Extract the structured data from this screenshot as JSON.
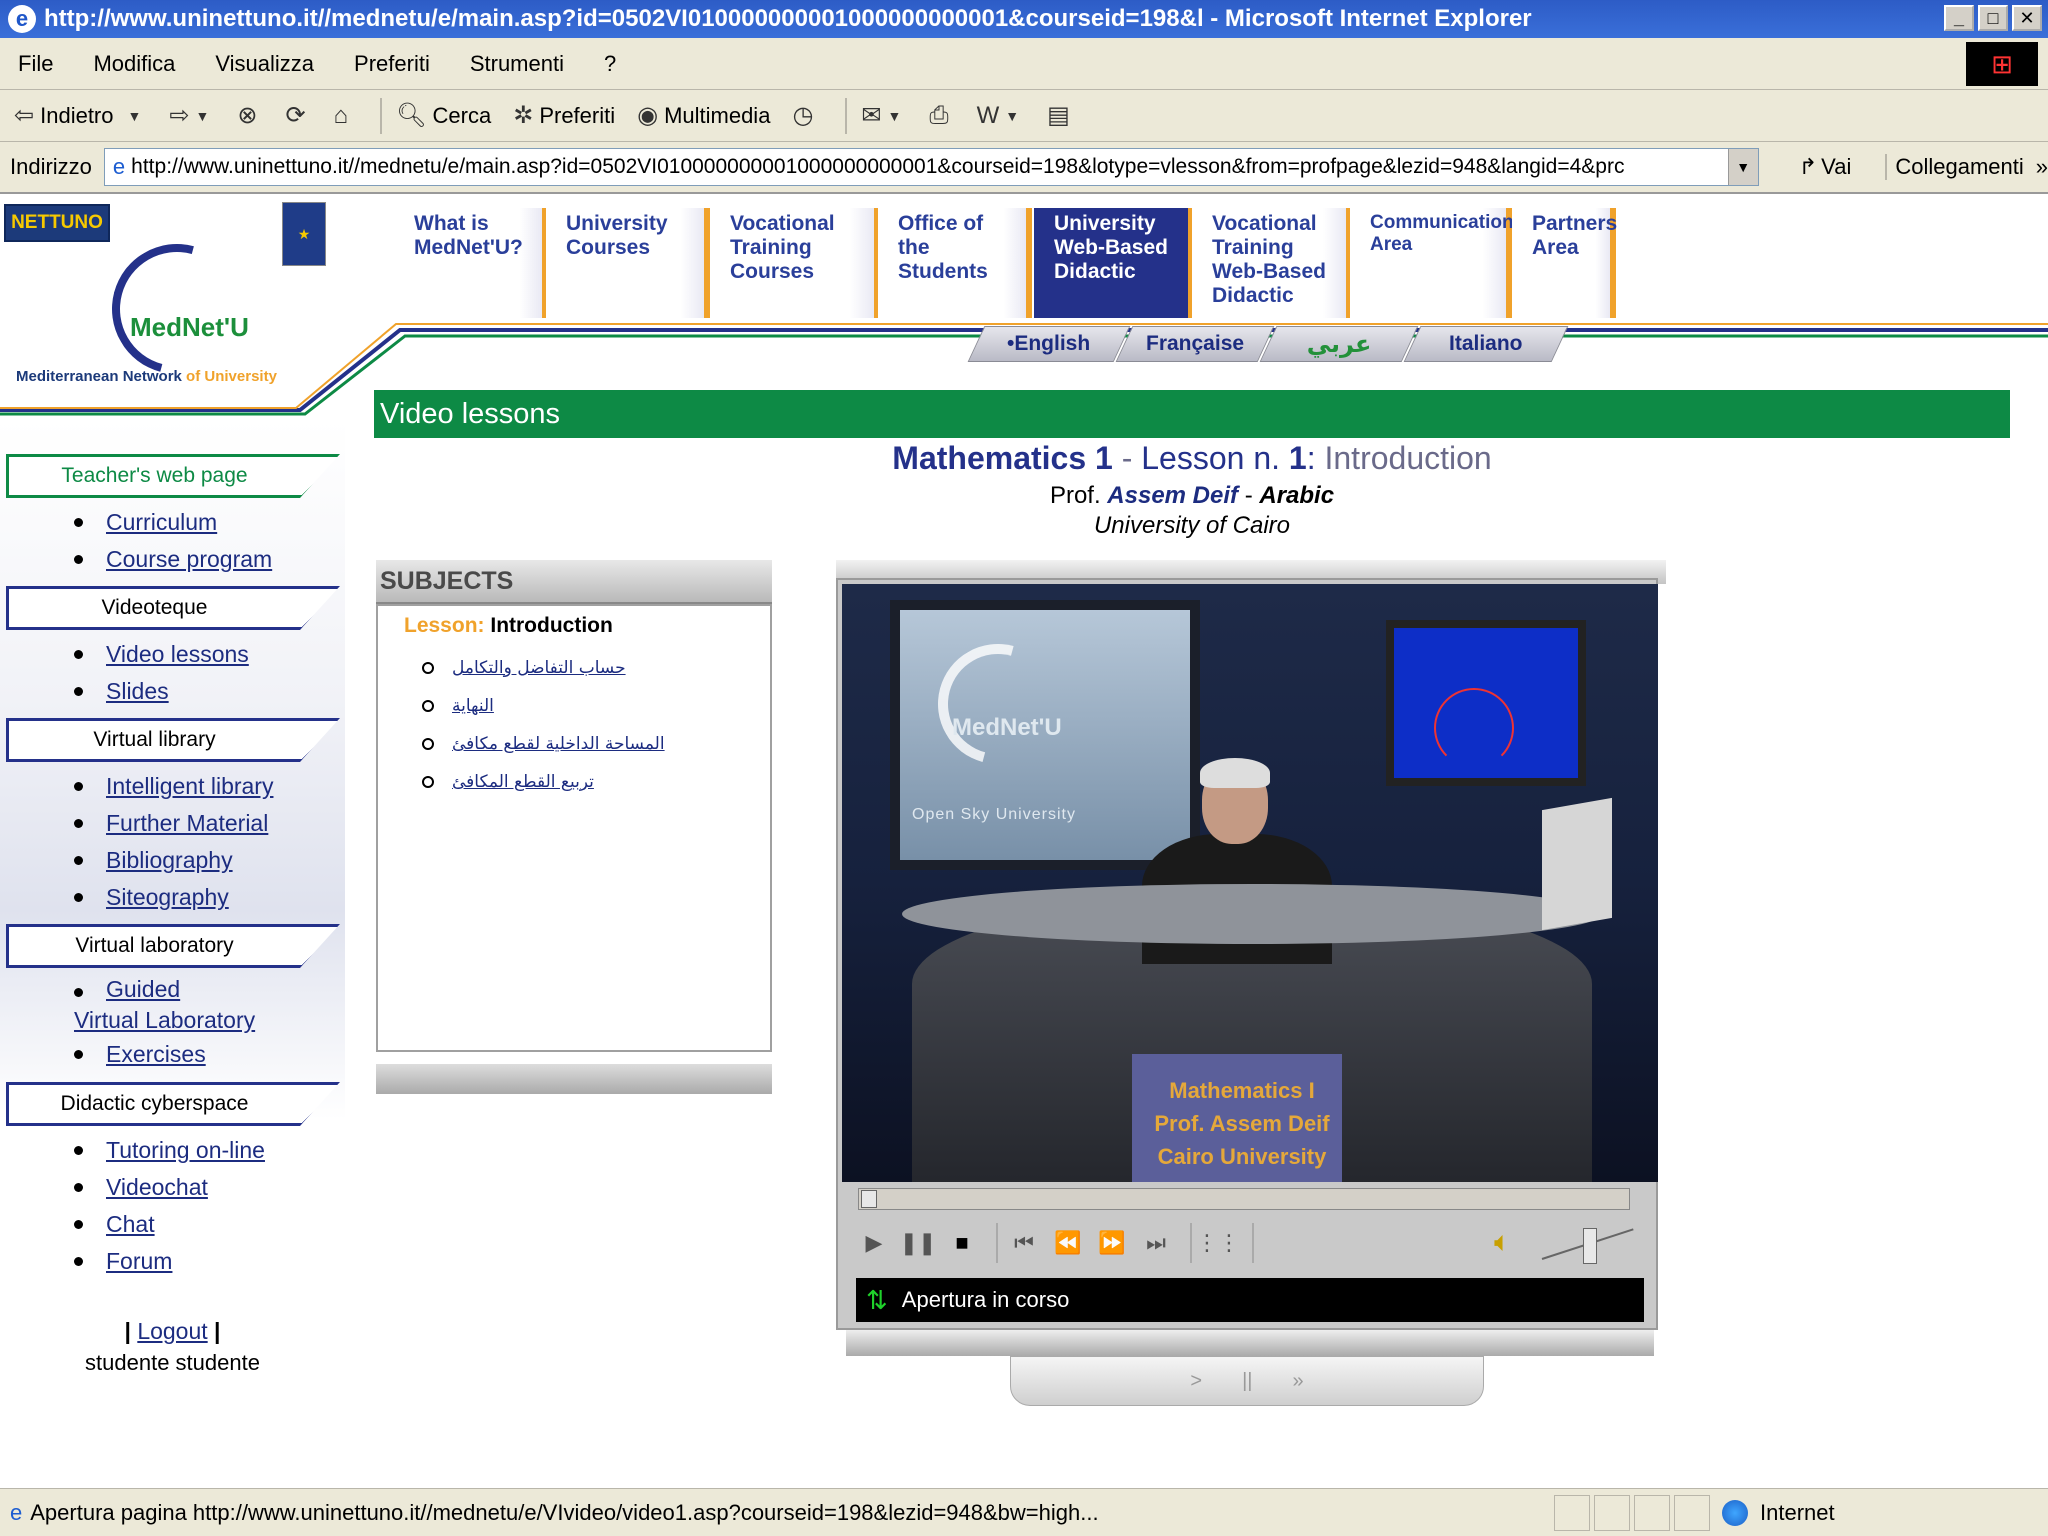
{
  "window": {
    "title": "http://www.uninettuno.it//mednetu/e/main.asp?id=0502VI010000000001000000000001&courseid=198&l - Microsoft Internet Explorer",
    "min": "_",
    "max": "□",
    "close": "✕"
  },
  "menu": [
    "File",
    "Modifica",
    "Visualizza",
    "Preferiti",
    "Strumenti",
    "?"
  ],
  "toolbar": {
    "back": "Indietro",
    "search": "Cerca",
    "favorites": "Preferiti",
    "media": "Multimedia"
  },
  "address": {
    "label": "Indirizzo",
    "url": "http://www.uninettuno.it//mednetu/e/main.asp?id=0502VI010000000001000000000001&courseid=198&lotype=vlesson&from=profpage&lezid=948&langid=4&prc",
    "go": "Vai",
    "links": "Collegamenti"
  },
  "logos": {
    "nettuno": "NETTUNO",
    "mednet": "MedNet'U",
    "tagline_a": "Mediterranean Network",
    "tagline_b": " of University"
  },
  "nav_tabs": [
    {
      "label": "What is MedNet'U?"
    },
    {
      "label": "University Courses"
    },
    {
      "label": "Vocational Training Courses"
    },
    {
      "label": "Office of the Students"
    },
    {
      "label": "University Web-Based Didactic"
    },
    {
      "label": "Vocational Training Web-Based Didactic"
    },
    {
      "label": "Communication Area"
    },
    {
      "label": "Partners Area"
    }
  ],
  "languages": {
    "english": "•English",
    "french": "Française",
    "arabic": "عربي",
    "italian": "Italiano"
  },
  "section_title": "Video lessons",
  "lesson": {
    "course": "Mathematics 1",
    "dash1": " - ",
    "lesson_no": "Lesson n. ",
    "lesson_num": "1",
    "colon": ": ",
    "topic": "Introduction",
    "prof_prefix": "Prof. ",
    "professor": "Assem Deif",
    "dash2": " - ",
    "language": "Arabic",
    "university": "University of Cairo"
  },
  "sidebar": {
    "teacher_head": "Teacher's web page",
    "teacher_items": [
      "Curriculum",
      "Course program"
    ],
    "videoteque_head": "Videoteque",
    "videoteque_items": [
      "Video lessons",
      "Slides"
    ],
    "library_head": "Virtual library",
    "library_items": [
      "Intelligent library",
      "Further Material",
      "Bibliography",
      "Siteography"
    ],
    "lab_head": "Virtual laboratory",
    "lab_items": [
      "Guided",
      "Virtual Laboratory",
      "Exercises"
    ],
    "cyber_head": "Didactic cyberspace",
    "cyber_items": [
      "Tutoring on-line",
      "Videochat",
      "Chat",
      "Forum"
    ],
    "logout": "Logout",
    "user": "studente studente"
  },
  "subjects": {
    "header": "SUBJECTS",
    "lesson_key": "Lesson:",
    "lesson_value": "Introduction",
    "items": [
      "حساب التفاضل والتكامل",
      "النهاية",
      "المساحة الداخلية لقطع مكافئ",
      "تربيع القطع المكافئ"
    ]
  },
  "video": {
    "backdrop_logo": "MedNet'U",
    "backdrop_sub": "Open Sky University",
    "desk_lines": [
      "Mathematics I",
      "Prof. Assem Deif",
      "Cairo University"
    ]
  },
  "player": {
    "status": "Apertura in corso",
    "progress": 0,
    "volume": 0.5
  },
  "statusbar": {
    "message": "Apertura pagina http://www.uninettuno.it//mednetu/e/VIvideo/video1.asp?courseid=198&lezid=948&bw=high...",
    "zone": "Internet"
  }
}
